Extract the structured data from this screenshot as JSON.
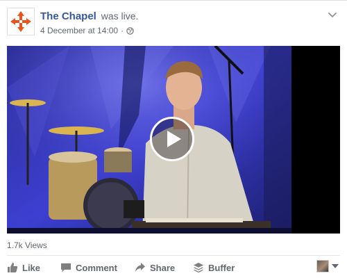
{
  "post": {
    "page_name": "The Chapel",
    "action_text": "was live.",
    "timestamp": "4 December at 14:00",
    "separator": "·",
    "privacy_icon": "globe-icon",
    "menu_icon": "chevron-down-icon"
  },
  "video": {
    "play_icon": "play-icon"
  },
  "stats": {
    "views": "1.7k Views"
  },
  "actions": {
    "like_label": "Like",
    "comment_label": "Comment",
    "share_label": "Share",
    "buffer_label": "Buffer"
  },
  "colors": {
    "brand_link": "#365899",
    "logo_orange": "#e8541c",
    "muted_text": "#616770"
  }
}
